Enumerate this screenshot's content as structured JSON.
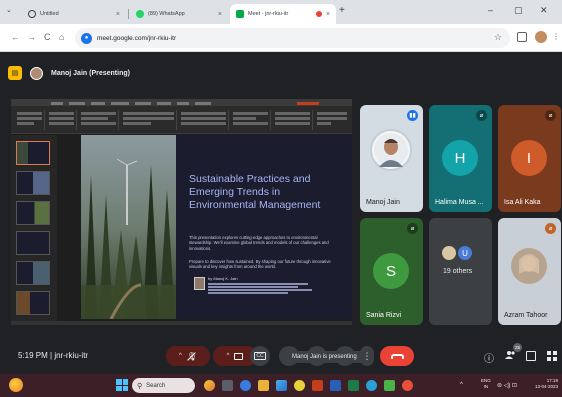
{
  "browser": {
    "tabs": [
      {
        "title": "Untitled",
        "close": "×",
        "active": false,
        "favicon_color": "#3c4043"
      },
      {
        "title": "(89) WhatsApp",
        "close": "×",
        "active": false,
        "favicon_color": "#25d366"
      },
      {
        "title": "Meet - jnr-rkiu-itr",
        "close": "×",
        "active": true,
        "favicon_color": "#00ac47"
      }
    ],
    "tab_list_icon": "⌄",
    "new_tab": "+",
    "window": {
      "minimize": "–",
      "maximize": "▢",
      "close": "✕"
    },
    "nav": {
      "back": "←",
      "forward": "→",
      "reload": "C",
      "home": "⌂"
    },
    "url": "meet.google.com/jnr-rkiu-itr",
    "star": "☆"
  },
  "meet": {
    "presenting_label": "Manoj Jain (Presenting)",
    "presenting_toast": "Manoj Jain is presenting",
    "time_code": "5:19 PM  |  jnr-rkiu-itr",
    "people_count": "25",
    "participants": [
      {
        "name": "Manoj Jain",
        "initial": "",
        "color": "#d3dbe3"
      },
      {
        "name": "Halima Musa ...",
        "initial": "H",
        "color": "#12a4a9"
      },
      {
        "name": "Isa Ali Kaka",
        "initial": "I",
        "color": "#cf5b2b"
      },
      {
        "name": "Sania Rizvi",
        "initial": "S",
        "color": "#3f9a3f"
      },
      {
        "name": "19 others",
        "initial": "",
        "color": "#3c4043"
      },
      {
        "name": "Azram Tahoor",
        "initial": "",
        "color": "#d0d4db"
      }
    ],
    "others_avatar_initial": "U",
    "controls": {
      "mic_off": "🎙",
      "cam_off": "▢",
      "captions": "CC",
      "emoji": "☺",
      "present": "⊡",
      "raise_hand": "✋",
      "more": "⋮",
      "leave": "✆",
      "info": "ⓘ",
      "people": "👥",
      "chat": "▤",
      "activities": "⋮⋮"
    }
  },
  "slide": {
    "title": "Sustainable Practices and Emerging Trends in Environmental Management",
    "body_1": "This presentation explores cutting-edge approaches to environmental stewardship. We'll examine global trends and models of our challenges and innovations.",
    "body_2": "Prepare to discover how sustained. By shaping our future through innovative visuals and key insights from around the world.",
    "author": "by Manoj K. Jain"
  },
  "taskbar": {
    "search_placeholder": "Search",
    "lang_1": "ENG",
    "lang_2": "IN",
    "time": "17:19",
    "date": "13-04-2023",
    "tray_caret": "^",
    "tray_icons": "⊜ ◁) ⊡"
  }
}
